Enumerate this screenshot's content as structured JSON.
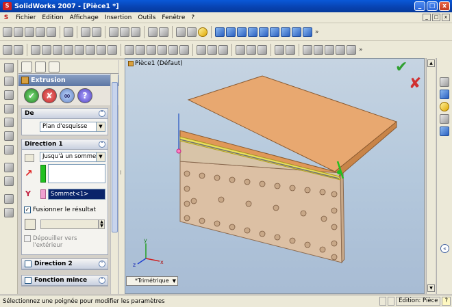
{
  "window": {
    "title": "SolidWorks 2007 - [Pièce1 *]",
    "min": "_",
    "max": "□",
    "close": "x"
  },
  "menu": {
    "items": [
      "Fichier",
      "Edition",
      "Affichage",
      "Insertion",
      "Outils",
      "Fenêtre",
      "?"
    ],
    "doc_min": "_",
    "doc_max": "□",
    "doc_close": "x"
  },
  "property_manager": {
    "title": "Extrusion",
    "section_de": {
      "title": "De",
      "from_value": "Plan d'esquisse"
    },
    "section_direction1": {
      "title": "Direction 1",
      "end_condition": "Jusqu'à un sommet",
      "vertex_value": "Sommet<1>",
      "merge_label": "Fusionner le résultat",
      "merge_checked": true,
      "draft_label_line1": "Dépouiller vers",
      "draft_label_line2": "l'extérieur"
    },
    "section_direction2": {
      "title": "Direction 2"
    },
    "section_thin": {
      "title": "Fonction mince"
    }
  },
  "viewport": {
    "tree_label": "Pièce1 (Défaut)",
    "view_name": "*Trimétrique",
    "confirm_ok": "✔",
    "confirm_cancel": "✘",
    "axis_x": "x",
    "axis_y": "y",
    "axis_z": "z"
  },
  "statusbar": {
    "message": "Sélectionnez une poignée pour modifier les paramètres",
    "mode": "Edition: Pièce",
    "help": "?"
  },
  "colors": {
    "part_face": "#e8a870",
    "part_side": "#dcc4a8",
    "highlight": "#e8e060",
    "accept": "#30a030",
    "reject": "#d03030"
  }
}
